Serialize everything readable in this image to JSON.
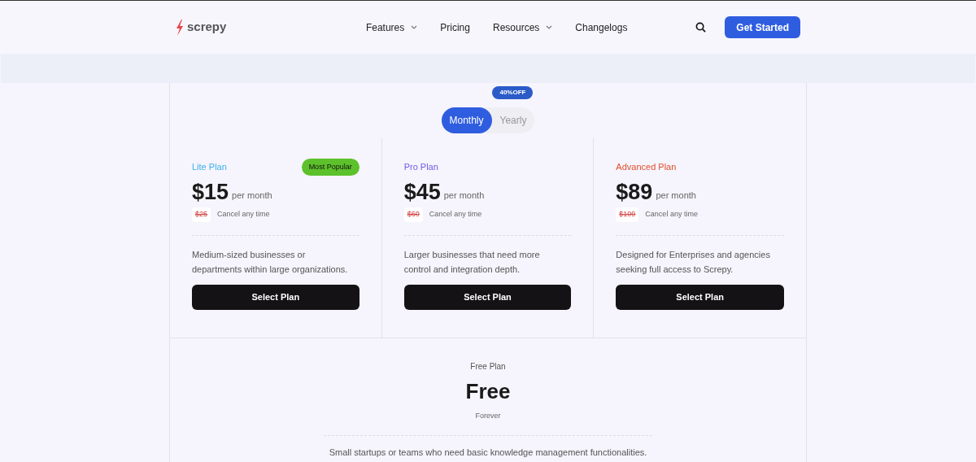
{
  "brand": {
    "name": "screpy"
  },
  "nav": [
    {
      "label": "Features",
      "dropdown": true
    },
    {
      "label": "Pricing",
      "dropdown": false
    },
    {
      "label": "Resources",
      "dropdown": true
    },
    {
      "label": "Changelogs",
      "dropdown": false
    }
  ],
  "cta": "Get Started",
  "billing": {
    "options": [
      {
        "label": "Monthly",
        "selected": true
      },
      {
        "label": "Yearly",
        "selected": false
      }
    ],
    "discount": "40%OFF"
  },
  "plans": [
    {
      "name": "Lite Plan",
      "color": "#3bb0e8",
      "badge": "Most Popular",
      "price": "$15",
      "period": "per month",
      "old_price": "$25",
      "note": "Cancel any time",
      "description": "Medium-sized businesses or departments within large organizations.",
      "button": "Select Plan"
    },
    {
      "name": "Pro Plan",
      "color": "#6d5ce8",
      "price": "$45",
      "period": "per month",
      "old_price": "$60",
      "note": "Cancel any time",
      "description": "Larger businesses that need more control and integration depth.",
      "button": "Select Plan"
    },
    {
      "name": "Advanced Plan",
      "color": "#e0502f",
      "price": "$89",
      "period": "per month",
      "old_price": "$109",
      "note": "Cancel any time",
      "description": "Designed for Enterprises and agencies seeking full access to Screpy.",
      "button": "Select Plan"
    }
  ],
  "free_plan": {
    "name": "Free Plan",
    "price": "Free",
    "period": "Forever",
    "description": "Small startups or teams who need basic knowledge management functionalities."
  }
}
